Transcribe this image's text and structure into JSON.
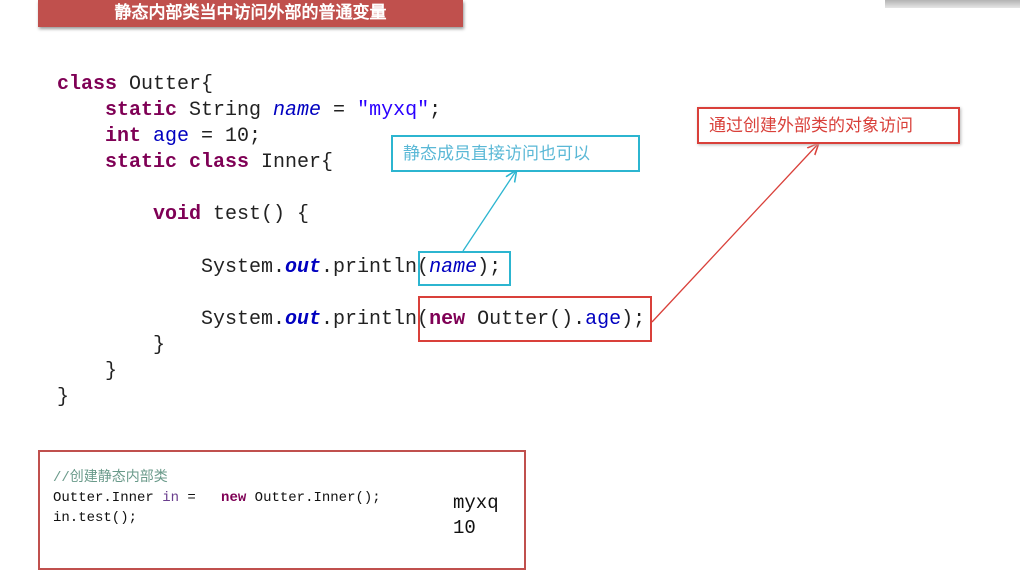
{
  "slide": {
    "title": "静态内部类当中访问外部的普通变量",
    "code_lines": [
      {
        "kw": "class",
        "rest": " Outter{"
      },
      {
        "kw": "static",
        "mid": " String ",
        "field": "name",
        "rest": " = ",
        "str": "\"myxq\"",
        "end": ";"
      },
      {
        "kw": "int",
        "field": "age",
        "rest": " = 10;"
      },
      {
        "kw": "static class",
        "rest": " Inner{"
      },
      {
        "kw": "void",
        "rest": " test() {"
      },
      {
        "pre": "System.",
        "field": "out",
        "rest": ".println(",
        "arg": "name",
        "end": ");"
      },
      {
        "pre": "System.",
        "field": "out",
        "rest": ".println(",
        "kw": "new",
        "mid": " Outter().",
        "arg": "age",
        "end": ");"
      },
      {
        "rest": "}"
      },
      {
        "rest": "}"
      },
      {
        "rest": "}"
      }
    ],
    "callout_blue": "静态成员直接访问也可以",
    "callout_red": "通过创建外部类的对象访问",
    "example": {
      "comment": "//创建静态内部类",
      "line1_a": "Outter.Inner ",
      "line1_var": "in",
      "line1_b": " =   ",
      "line1_kw": "new",
      "line1_c": " Outter.Inner();",
      "line2": "in.test();",
      "output": [
        "myxq",
        "10"
      ]
    },
    "colors": {
      "banner": "#c0504d",
      "blue_callout": "#2cb5d0",
      "red_callout": "#d9403a",
      "keyword": "#7f0055",
      "field": "#0000c0"
    }
  }
}
